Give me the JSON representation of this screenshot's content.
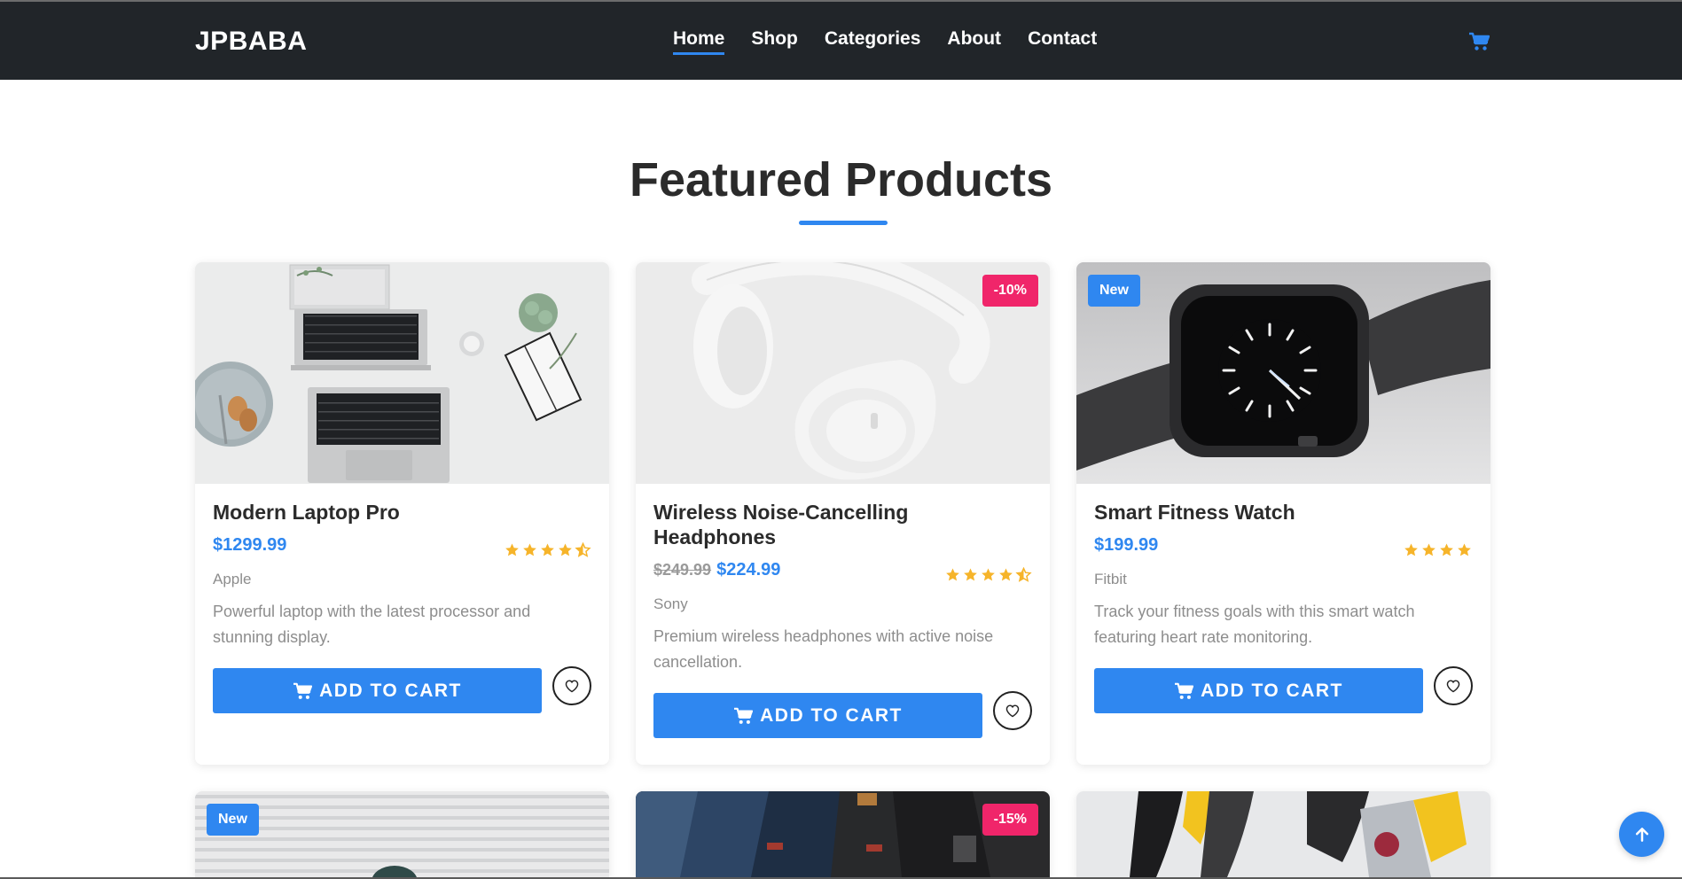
{
  "navbar": {
    "brand": "JPBABA",
    "links": [
      {
        "label": "Home",
        "active": true
      },
      {
        "label": "Shop"
      },
      {
        "label": "Categories"
      },
      {
        "label": "About"
      },
      {
        "label": "Contact"
      }
    ],
    "cart_icon": "cart-icon"
  },
  "section": {
    "title": "Featured Products"
  },
  "products": [
    {
      "name": "Modern Laptop Pro",
      "price": "$1299.99",
      "old_price": "",
      "rating": 4.5,
      "brand": "Apple",
      "description": "Powerful laptop with the latest processor and stunning display.",
      "badge": "",
      "button": "ADD TO CART"
    },
    {
      "name": "Wireless Noise-Cancelling Headphones",
      "price": "$224.99",
      "old_price": "$249.99",
      "rating": 4.5,
      "brand": "Sony",
      "description": "Premium wireless headphones with active noise cancellation.",
      "badge": "-10%",
      "button": "ADD TO CART"
    },
    {
      "name": "Smart Fitness Watch",
      "price": "$199.99",
      "old_price": "",
      "rating": 4,
      "brand": "Fitbit",
      "description": "Track your fitness goals with this smart watch featuring heart rate monitoring.",
      "badge": "New",
      "button": "ADD TO CART"
    }
  ],
  "partial_products": [
    {
      "badge": "New"
    },
    {
      "badge": "-15%"
    },
    {
      "badge": ""
    }
  ],
  "colors": {
    "accent": "#2f87f0",
    "sale_badge": "#f0256a",
    "navbar_bg": "#212529",
    "star": "#f6b42a"
  }
}
